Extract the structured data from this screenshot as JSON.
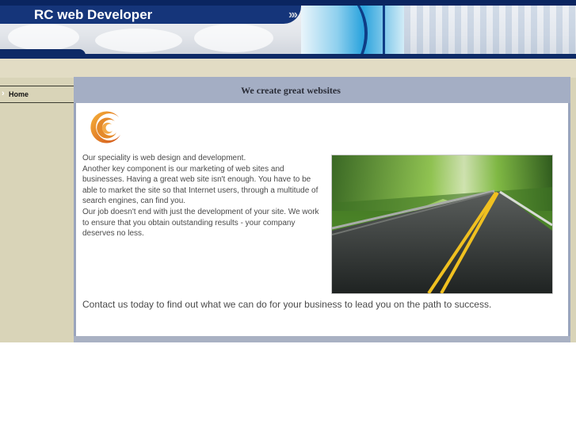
{
  "header": {
    "site_title": "RC web Developer"
  },
  "sidebar": {
    "items": [
      {
        "label": "Home",
        "icon": "chevron-right-icon"
      }
    ]
  },
  "main": {
    "heading": "We create great websites",
    "logo": "swirl-logo",
    "intro_lines": [
      "Our speciality is web design and development.",
      "Another key component is our marketing of web sites and businesses. Having a great web site isn't enough. You have to be able to market the site so that Internet users, through a multitude of search engines, can find you.",
      "Our job doesn't end with just the development of your site. We work to ensure that you obtain outstanding results - your company deserves no less."
    ],
    "photo": "road-through-forest-image",
    "contact_line": "Contact us today to find out what we can do for your business to lead you on the path to success."
  },
  "colors": {
    "header_bar": "#15357a",
    "body_band": "#d9d4b8",
    "panel_frame": "#9aa5bd",
    "text": "#4a4a4a"
  }
}
